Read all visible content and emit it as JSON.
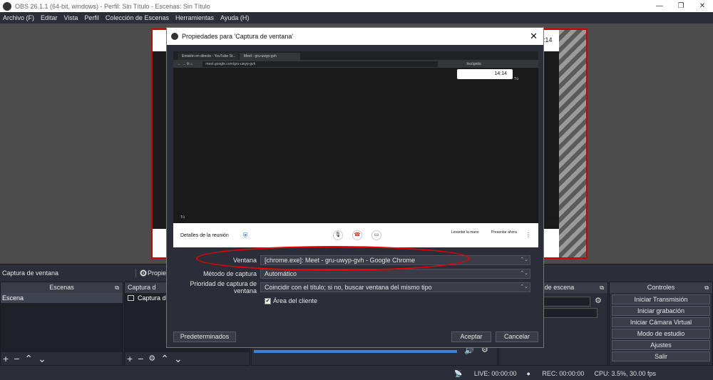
{
  "window": {
    "title": "OBS 26.1.1 (64-bit, windows) - Perfil: Sin Título - Escenas: Sin Título",
    "minimize": "—",
    "maximize": "❐",
    "close": "✕"
  },
  "menu": [
    "Archivo (F)",
    "Editar",
    "Vista",
    "Perfil",
    "Colección de Escenas",
    "Herramientas",
    "Ayuda (H)"
  ],
  "source_toolbar": {
    "selected_source": "Captura de ventana",
    "properties_label": "Propie"
  },
  "preview": {
    "right_peek_text": ":14",
    "right_peek_text2": "r ahora"
  },
  "docks": {
    "scenes": {
      "title": "Escenas",
      "items": [
        "Escena"
      ]
    },
    "sources": {
      "title": "Captura d",
      "items": [
        "Captura de"
      ]
    },
    "transitions": {
      "title": "nes de escena",
      "field1": "nto",
      "field2": "ms"
    },
    "controls": {
      "title": "Controles",
      "buttons": [
        "Iniciar Transmisión",
        "Iniciar grabación",
        "Iniciar Cámara Virtual",
        "Modo de estudio",
        "Ajustes",
        "Salir"
      ]
    }
  },
  "status": {
    "live": "LIVE: 00:00:00",
    "rec": "REC: 00:00:00",
    "cpu": "CPU: 3.5%, 30.00 fps"
  },
  "dialog": {
    "title": "Propiedades para 'Captura de ventana'",
    "close": "✕",
    "preview": {
      "tab1": "Emisión en directo - YouTube St...",
      "tab2": "Meet - gru-uwyp-gvh",
      "url": "meet.google.com/gru-uwyp-gvh",
      "incognito": "Incógnito",
      "time": "14:14",
      "tu": "Tú",
      "details": "Detalles de la reunión",
      "raise_hand": "Levantar la mano",
      "present": "Presentar ahora"
    },
    "fields": [
      {
        "label": "Ventana",
        "value": "[chrome.exe]: Meet - gru-uwyp-gvh - Google Chrome"
      },
      {
        "label": "Método de captura",
        "value": "Automático"
      },
      {
        "label": "Prioridad de captura de ventana",
        "value": "Coincidir con el título; si no, buscar ventana del mismo tipo"
      }
    ],
    "client_area": {
      "label": "Área del cliente",
      "checked": true
    },
    "buttons": {
      "defaults": "Predeterminados",
      "accept": "Aceptar",
      "cancel": "Cancelar"
    }
  },
  "colors": {
    "accent_red": "#d30000",
    "annotation": "#e00000"
  }
}
